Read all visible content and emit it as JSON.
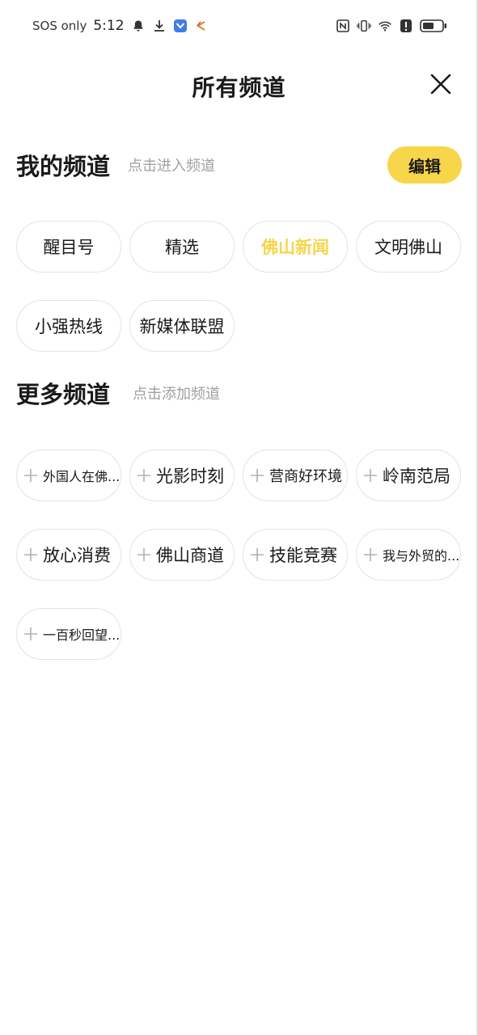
{
  "status_bar": {
    "carrier": "SOS only",
    "time": "5:12"
  },
  "header": {
    "title": "所有频道"
  },
  "my_channels": {
    "title": "我的频道",
    "hint": "点击进入频道",
    "edit_label": "编辑",
    "items": [
      {
        "label": "醒目号"
      },
      {
        "label": "精选"
      },
      {
        "label": "佛山新闻"
      },
      {
        "label": "文明佛山"
      },
      {
        "label": "小强热线"
      },
      {
        "label": "新媒体联盟"
      }
    ]
  },
  "more_channels": {
    "title": "更多频道",
    "hint": "点击添加频道",
    "items": [
      {
        "label": "外国人在佛..."
      },
      {
        "label": "光影时刻"
      },
      {
        "label": "营商好环境"
      },
      {
        "label": "岭南范局"
      },
      {
        "label": "放心消费"
      },
      {
        "label": "佛山商道"
      },
      {
        "label": "技能竞赛"
      },
      {
        "label": "我与外贸的..."
      },
      {
        "label": "一百秒回望..."
      }
    ]
  },
  "colors": {
    "accent": "#f8d64a",
    "active_text": "#f6d548",
    "hint_text": "#a0a0a0",
    "chip_border": "#e3e3e3"
  }
}
